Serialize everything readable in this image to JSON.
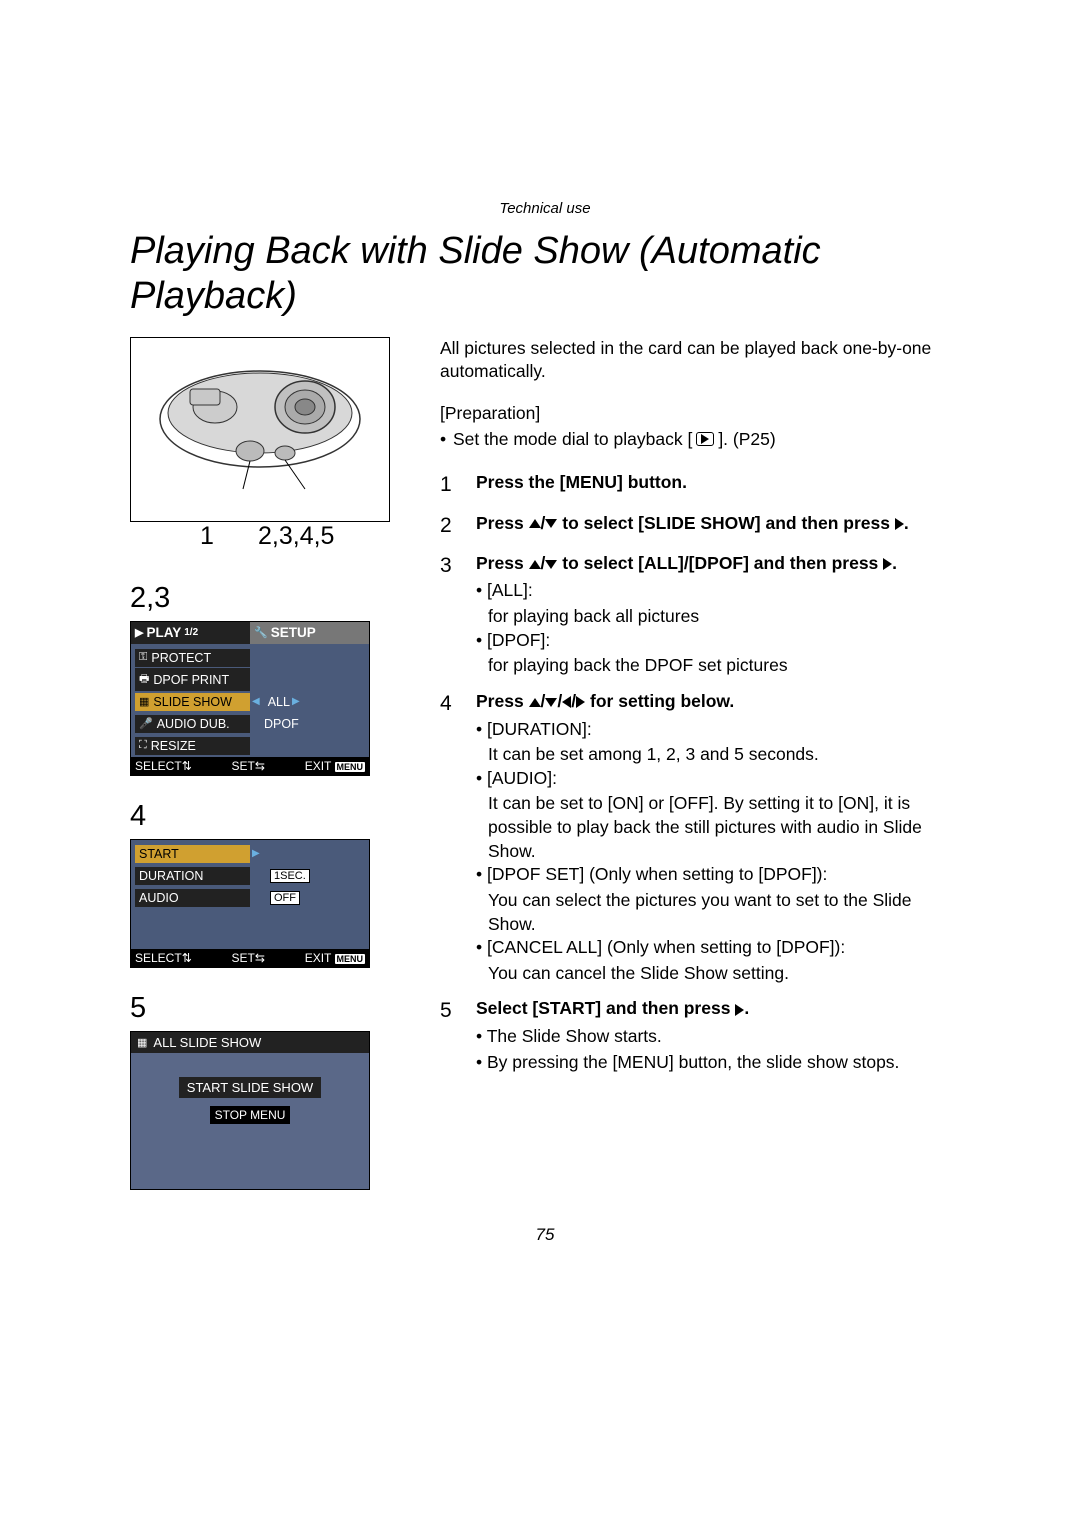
{
  "header_category": "Technical use",
  "title": "Playing Back with Slide Show (Automatic Playback)",
  "callouts": {
    "c1": "1",
    "c2": "2,3,4,5"
  },
  "left": {
    "sec23_label": "2,3",
    "sec4_label": "4",
    "sec5_label": "5",
    "screen23": {
      "tab_play": "PLAY",
      "tab_play_page": "1/2",
      "tab_setup": "SETUP",
      "items": {
        "protect": "PROTECT",
        "dpof_print": "DPOF PRINT",
        "slide_show": "SLIDE SHOW",
        "audio_dub": "AUDIO DUB.",
        "resize": "RESIZE"
      },
      "values": {
        "all": "ALL",
        "dpof": "DPOF"
      },
      "footer": {
        "select": "SELECT",
        "set": "SET",
        "exit": "EXIT",
        "menu": "MENU"
      }
    },
    "screen4": {
      "items": {
        "start": "START",
        "duration": "DURATION",
        "audio": "AUDIO"
      },
      "values": {
        "duration": "1SEC.",
        "audio": "OFF"
      },
      "footer": {
        "select": "SELECT",
        "set": "SET",
        "exit": "EXIT",
        "menu": "MENU"
      }
    },
    "screen5": {
      "header": "ALL SLIDE SHOW",
      "start": "START SLIDE SHOW",
      "stop": "STOP",
      "menu": "MENU"
    }
  },
  "right": {
    "intro": "All pictures selected in the card can be played back one-by-one automatically.",
    "prep_label": "[Preparation]",
    "prep_item_pre": "Set the mode dial to playback [",
    "prep_item_post": "]. (P25)",
    "steps": {
      "s1": {
        "num": "1",
        "head": "Press the [MENU] button."
      },
      "s2": {
        "num": "2",
        "head_pre": "Press ",
        "head_mid": " to select [SLIDE SHOW] and then press ",
        "head_post": "."
      },
      "s3": {
        "num": "3",
        "head_pre": "Press ",
        "head_mid": " to select [ALL]/[DPOF] and then press ",
        "head_post": ".",
        "b1_label": "[ALL]:",
        "b1_text": "for playing back all pictures",
        "b2_label": "[DPOF]:",
        "b2_text": "for playing back the DPOF set pictures"
      },
      "s4": {
        "num": "4",
        "head_pre": "Press ",
        "head_post": " for setting below.",
        "b1_label": "[DURATION]:",
        "b1_text": "It can be set among 1, 2, 3 and 5 seconds.",
        "b2_label": "[AUDIO]:",
        "b2_text": "It can be set to [ON] or [OFF]. By setting it to [ON], it is possible to play back the still pictures with audio in Slide Show.",
        "b3_label": "[DPOF SET] (Only when setting to [DPOF]):",
        "b3_text": "You can select the pictures you want to set to the Slide Show.",
        "b4_label": "[CANCEL ALL] (Only when setting to [DPOF]):",
        "b4_text": "You can cancel the Slide Show setting."
      },
      "s5": {
        "num": "5",
        "head_pre": "Select [START] and then press ",
        "head_post": ".",
        "b1": "The Slide Show starts.",
        "b2": "By pressing the [MENU] button, the slide show stops."
      }
    }
  },
  "page_number": "75"
}
